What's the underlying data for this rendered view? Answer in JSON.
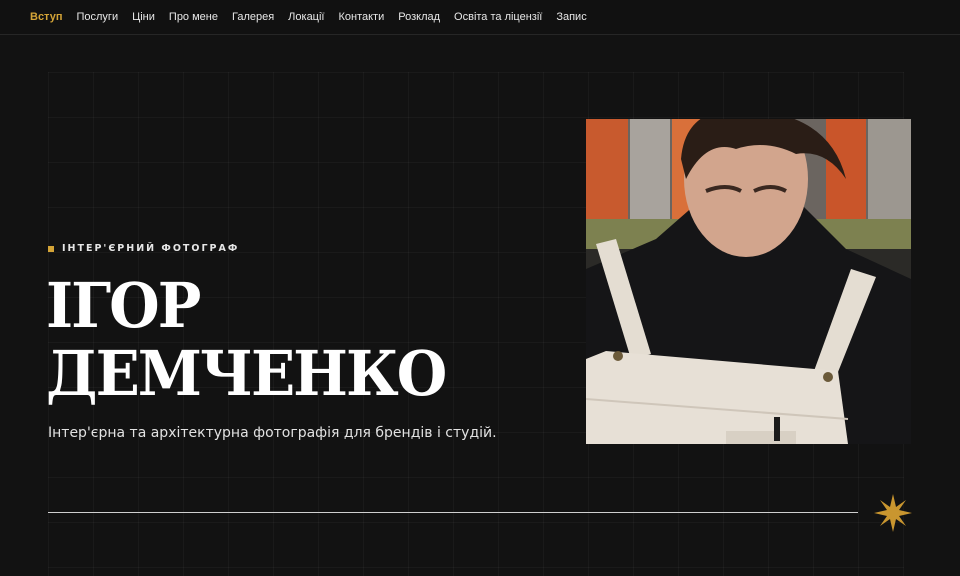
{
  "nav": {
    "items": [
      {
        "label": "Вступ",
        "active": true
      },
      {
        "label": "Послуги",
        "active": false
      },
      {
        "label": "Ціни",
        "active": false
      },
      {
        "label": "Про мене",
        "active": false
      },
      {
        "label": "Галерея",
        "active": false
      },
      {
        "label": "Локації",
        "active": false
      },
      {
        "label": "Контакти",
        "active": false
      },
      {
        "label": "Розклад",
        "active": false
      },
      {
        "label": "Освіта та ліцензії",
        "active": false
      },
      {
        "label": "Запис",
        "active": false
      }
    ]
  },
  "hero": {
    "eyebrow": "ІНТЕР'ЄРНИЙ ФОТОГРАФ",
    "name_line1": "ІГОР",
    "name_line2": "ДЕМЧЕНКО",
    "tagline": "Інтер'єрна та архітектурна фотографія для брендів і студій."
  },
  "colors": {
    "accent": "#d4a437",
    "background": "#121212",
    "text": "#ffffff"
  },
  "icons": {
    "eyebrow_marker": "square-bullet",
    "decor": "eight-point-star-icon"
  }
}
